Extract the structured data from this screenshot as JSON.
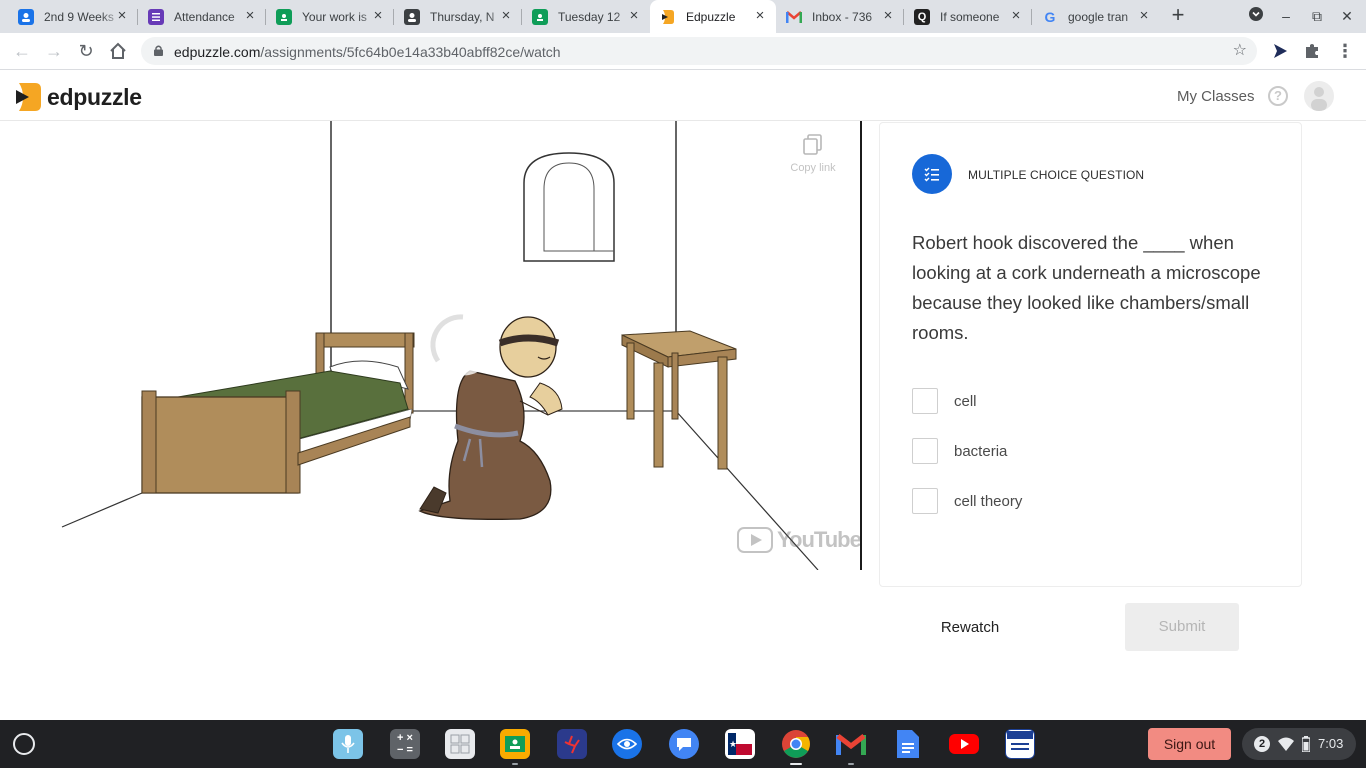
{
  "browser": {
    "tabs": [
      {
        "title": "2nd 9 Weeks",
        "icon": "classroom-person-icon",
        "color": "#1a73e8"
      },
      {
        "title": "Attendance",
        "icon": "forms-icon",
        "color": "#673ab7"
      },
      {
        "title": "Your work is",
        "icon": "classroom-icon",
        "color": "#0f9d58"
      },
      {
        "title": "Thursday, N",
        "icon": "classroom-person-icon",
        "color": "#3c4043"
      },
      {
        "title": "Tuesday 12",
        "icon": "classroom-icon",
        "color": "#0f9d58"
      },
      {
        "title": "Edpuzzle",
        "icon": "edpuzzle-icon",
        "color": "#f5a623",
        "active": true
      },
      {
        "title": "Inbox - 736",
        "icon": "gmail-icon",
        "color": "#ea4335"
      },
      {
        "title": "If someone",
        "icon": "quora-icon",
        "color": "#222222"
      },
      {
        "title": "google tran",
        "icon": "google-icon",
        "color": "#4285f4"
      }
    ],
    "url_domain": "edpuzzle.com",
    "url_path": "/assignments/5fc64b0e14a33b40abff82ce/watch"
  },
  "header": {
    "logo_text": "edpuzzle",
    "my_classes": "My Classes",
    "help_symbol": "?"
  },
  "video": {
    "copy_link": "Copy link",
    "watermark": "YouTube"
  },
  "question": {
    "type_label": "MULTIPLE CHOICE QUESTION",
    "text": "Robert hook discovered the ____ when looking at a cork underneath a microscope because they looked like chambers/small rooms.",
    "options": [
      "cell",
      "bacteria",
      "cell theory"
    ],
    "accent_color": "#1768d8"
  },
  "actions": {
    "rewatch": "Rewatch",
    "submit": "Submit"
  },
  "shelf": {
    "sign_out": "Sign out",
    "notifications": "2",
    "time": "7:03"
  }
}
